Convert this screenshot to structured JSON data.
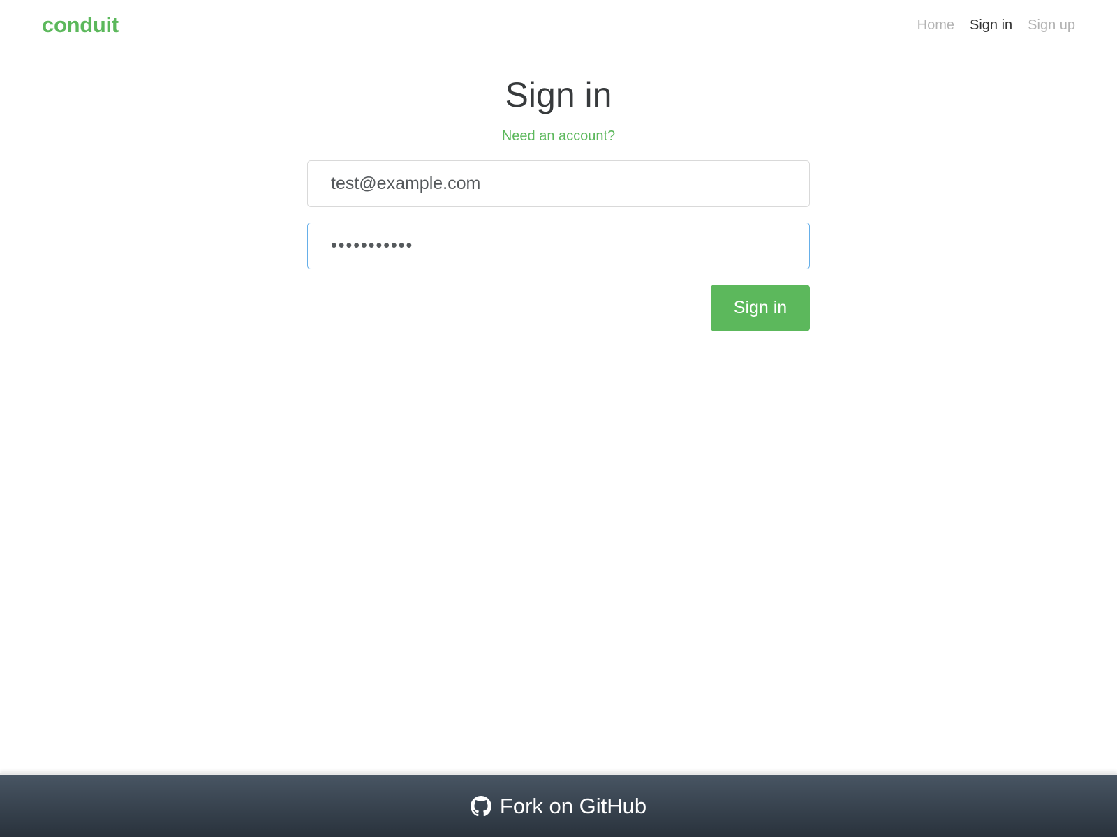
{
  "navbar": {
    "brand": "conduit",
    "links": [
      {
        "label": "Home",
        "active": false
      },
      {
        "label": "Sign in",
        "active": true
      },
      {
        "label": "Sign up",
        "active": false
      }
    ]
  },
  "auth": {
    "title": "Sign in",
    "need_account": "Need an account?",
    "email_value": "test@example.com",
    "password_value": "•••••••••••",
    "submit_label": "Sign in"
  },
  "footer": {
    "icon": "github-icon",
    "label": "Fork on GitHub"
  },
  "colors": {
    "brand": "#5cb85c",
    "focus_border": "#66afe9",
    "title_text": "#373a3c",
    "footer_top": "#485563",
    "footer_bottom": "#29323c"
  }
}
